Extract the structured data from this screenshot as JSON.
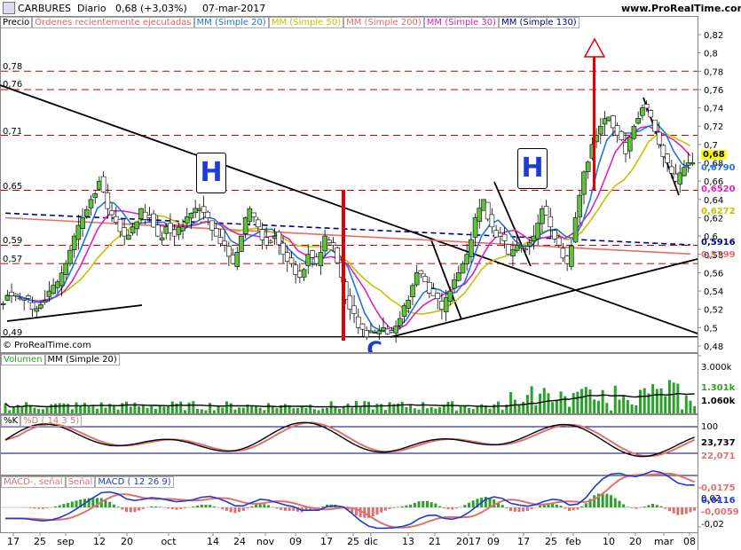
{
  "header": {
    "symbol": "CARBURES",
    "period": "Diario",
    "last": "0,68 (+3,03%)",
    "date": "07-mar-2017",
    "site": "www.ProRealTime.com"
  },
  "price_panel": {
    "legend": [
      {
        "label": "Precio",
        "color": "#000000"
      },
      {
        "label": "Órdenes recientemente ejecutadas",
        "color": "#e06666"
      },
      {
        "label": "MM (Simple 20)",
        "color": "#1e78d7"
      },
      {
        "label": "MM (Simple 50)",
        "color": "#c8c000"
      },
      {
        "label": "MM (Simple 200)",
        "color": "#e07070"
      },
      {
        "label": "MM (Simple 30)",
        "color": "#e020c0"
      },
      {
        "label": "MM (Simple 130)",
        "color": "#00008b"
      }
    ],
    "y_ticks": [
      "0,82",
      "0,8",
      "0,78",
      "0,76",
      "0,74",
      "0,72",
      "0,7",
      "0,68",
      "0,66",
      "0,64",
      "0,62",
      "0,6",
      "0,58",
      "0,56",
      "0,54",
      "0,52",
      "0,5",
      "0,48"
    ],
    "level_labels": [
      "0,78",
      "0,76",
      "0,71",
      "0,65",
      "0,59",
      "0,57",
      "0,49"
    ],
    "tags": [
      {
        "text": "0,68",
        "bg": "#ffff00",
        "fg": "#000000"
      },
      {
        "text": "0,6790",
        "bg": "#ffffff",
        "fg": "#1e78d7"
      },
      {
        "text": "0,6520",
        "bg": "#ffffff",
        "fg": "#e020c0"
      },
      {
        "text": "0,6272",
        "bg": "#ffffff",
        "fg": "#c8c000"
      },
      {
        "text": "0,5916",
        "bg": "#ffffff",
        "fg": "#00008b"
      },
      {
        "text": "0,5799",
        "bg": "#ffffff",
        "fg": "#e07070"
      }
    ],
    "pattern_letters": [
      "H",
      "H",
      "C"
    ],
    "copyright": "© ProRealTime.com"
  },
  "volume_panel": {
    "legend": [
      {
        "label": "Volumen",
        "color": "#2ca02c"
      },
      {
        "label": "MM (Simple 20)",
        "color": "#000000"
      }
    ],
    "y_ticks": [
      "3.000k"
    ],
    "tags": [
      {
        "text": "1.301k",
        "fg": "#2ca02c"
      },
      {
        "text": "1.060k",
        "fg": "#000000"
      }
    ]
  },
  "stoch_panel": {
    "legend": [
      {
        "label": "%K",
        "color": "#000000"
      },
      {
        "label": "%D ( 14 3 5)",
        "color": "#e07070"
      }
    ],
    "y_ticks": [
      "100"
    ],
    "tags": [
      {
        "text": "23,737",
        "fg": "#000000"
      },
      {
        "text": "22,071",
        "fg": "#e07070"
      }
    ]
  },
  "macd_panel": {
    "legend": [
      {
        "label": "MACD-, señal",
        "color": "#e07070"
      },
      {
        "label": "Señal",
        "color": "#e07070"
      },
      {
        "label": "MACD ( 12 26 9)",
        "color": "#1e3cd0"
      }
    ],
    "y_ticks": [
      "0,02",
      "-0,02"
    ],
    "tags": [
      {
        "text": "0,0175",
        "fg": "#e07070"
      },
      {
        "text": "0,0116",
        "fg": "#1e3cd0"
      },
      {
        "text": "-0,0059",
        "fg": "#e07070"
      }
    ]
  },
  "x_axis": [
    "17",
    "25",
    "sep",
    "12",
    "20",
    "oct",
    "14",
    "24",
    "nov",
    "09",
    "17",
    "25",
    "dic",
    "13",
    "21",
    "2017",
    "09",
    "17",
    "25",
    "feb",
    "10",
    "20",
    "mar",
    "08"
  ],
  "chart_data": {
    "type": "candlestick",
    "title": "CARBURES Diario",
    "ylim": [
      0.475,
      0.83
    ],
    "close_path": [
      0.535,
      0.535,
      0.53,
      0.52,
      0.525,
      0.54,
      0.55,
      0.57,
      0.6,
      0.62,
      0.64,
      0.66,
      0.63,
      0.615,
      0.6,
      0.61,
      0.63,
      0.62,
      0.6,
      0.61,
      0.6,
      0.61,
      0.625,
      0.63,
      0.62,
      0.6,
      0.59,
      0.57,
      0.6,
      0.63,
      0.61,
      0.59,
      0.6,
      0.58,
      0.57,
      0.555,
      0.58,
      0.57,
      0.6,
      0.59,
      0.555,
      0.52,
      0.5,
      0.49,
      0.495,
      0.5,
      0.495,
      0.51,
      0.53,
      0.56,
      0.55,
      0.535,
      0.52,
      0.54,
      0.56,
      0.58,
      0.62,
      0.64,
      0.61,
      0.6,
      0.58,
      0.59,
      0.585,
      0.6,
      0.63,
      0.61,
      0.59,
      0.57,
      0.62,
      0.67,
      0.7,
      0.72,
      0.73,
      0.71,
      0.69,
      0.72,
      0.74,
      0.73,
      0.7,
      0.68,
      0.66,
      0.675,
      0.68
    ],
    "horizontal_levels": [
      0.78,
      0.76,
      0.71,
      0.65,
      0.59,
      0.57,
      0.49
    ],
    "ma_last": {
      "MM (Simple 20)": 0.679,
      "MM (Simple 30)": 0.652,
      "MM (Simple 50)": 0.6272,
      "MM (Simple 130)": 0.5916,
      "MM (Simple 200)": 0.5799
    },
    "volume_ylim": [
      0,
      3000
    ],
    "volume_last": 1301,
    "volume_ma_last": 1060,
    "stoch_k_last": 23.737,
    "stoch_d_last": 22.071,
    "macd_last": 0.0116,
    "macd_signal_last": 0.0175,
    "macd_hist_last": -0.0059
  }
}
